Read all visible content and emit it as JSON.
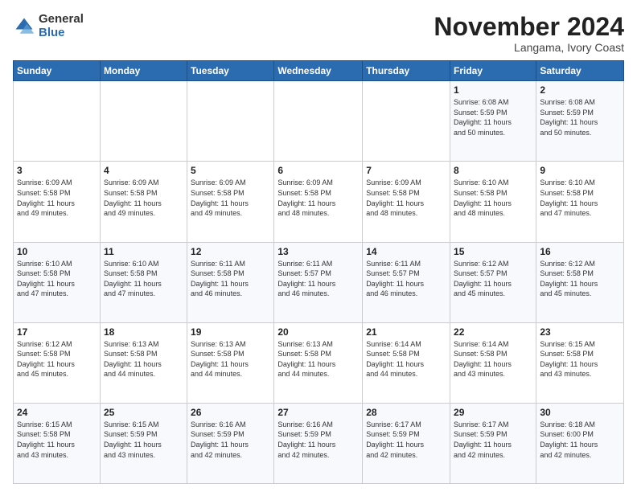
{
  "logo": {
    "general": "General",
    "blue": "Blue"
  },
  "header": {
    "title": "November 2024",
    "location": "Langama, Ivory Coast"
  },
  "weekdays": [
    "Sunday",
    "Monday",
    "Tuesday",
    "Wednesday",
    "Thursday",
    "Friday",
    "Saturday"
  ],
  "weeks": [
    [
      {
        "day": "",
        "info": ""
      },
      {
        "day": "",
        "info": ""
      },
      {
        "day": "",
        "info": ""
      },
      {
        "day": "",
        "info": ""
      },
      {
        "day": "",
        "info": ""
      },
      {
        "day": "1",
        "info": "Sunrise: 6:08 AM\nSunset: 5:59 PM\nDaylight: 11 hours\nand 50 minutes."
      },
      {
        "day": "2",
        "info": "Sunrise: 6:08 AM\nSunset: 5:59 PM\nDaylight: 11 hours\nand 50 minutes."
      }
    ],
    [
      {
        "day": "3",
        "info": "Sunrise: 6:09 AM\nSunset: 5:58 PM\nDaylight: 11 hours\nand 49 minutes."
      },
      {
        "day": "4",
        "info": "Sunrise: 6:09 AM\nSunset: 5:58 PM\nDaylight: 11 hours\nand 49 minutes."
      },
      {
        "day": "5",
        "info": "Sunrise: 6:09 AM\nSunset: 5:58 PM\nDaylight: 11 hours\nand 49 minutes."
      },
      {
        "day": "6",
        "info": "Sunrise: 6:09 AM\nSunset: 5:58 PM\nDaylight: 11 hours\nand 48 minutes."
      },
      {
        "day": "7",
        "info": "Sunrise: 6:09 AM\nSunset: 5:58 PM\nDaylight: 11 hours\nand 48 minutes."
      },
      {
        "day": "8",
        "info": "Sunrise: 6:10 AM\nSunset: 5:58 PM\nDaylight: 11 hours\nand 48 minutes."
      },
      {
        "day": "9",
        "info": "Sunrise: 6:10 AM\nSunset: 5:58 PM\nDaylight: 11 hours\nand 47 minutes."
      }
    ],
    [
      {
        "day": "10",
        "info": "Sunrise: 6:10 AM\nSunset: 5:58 PM\nDaylight: 11 hours\nand 47 minutes."
      },
      {
        "day": "11",
        "info": "Sunrise: 6:10 AM\nSunset: 5:58 PM\nDaylight: 11 hours\nand 47 minutes."
      },
      {
        "day": "12",
        "info": "Sunrise: 6:11 AM\nSunset: 5:58 PM\nDaylight: 11 hours\nand 46 minutes."
      },
      {
        "day": "13",
        "info": "Sunrise: 6:11 AM\nSunset: 5:57 PM\nDaylight: 11 hours\nand 46 minutes."
      },
      {
        "day": "14",
        "info": "Sunrise: 6:11 AM\nSunset: 5:57 PM\nDaylight: 11 hours\nand 46 minutes."
      },
      {
        "day": "15",
        "info": "Sunrise: 6:12 AM\nSunset: 5:57 PM\nDaylight: 11 hours\nand 45 minutes."
      },
      {
        "day": "16",
        "info": "Sunrise: 6:12 AM\nSunset: 5:58 PM\nDaylight: 11 hours\nand 45 minutes."
      }
    ],
    [
      {
        "day": "17",
        "info": "Sunrise: 6:12 AM\nSunset: 5:58 PM\nDaylight: 11 hours\nand 45 minutes."
      },
      {
        "day": "18",
        "info": "Sunrise: 6:13 AM\nSunset: 5:58 PM\nDaylight: 11 hours\nand 44 minutes."
      },
      {
        "day": "19",
        "info": "Sunrise: 6:13 AM\nSunset: 5:58 PM\nDaylight: 11 hours\nand 44 minutes."
      },
      {
        "day": "20",
        "info": "Sunrise: 6:13 AM\nSunset: 5:58 PM\nDaylight: 11 hours\nand 44 minutes."
      },
      {
        "day": "21",
        "info": "Sunrise: 6:14 AM\nSunset: 5:58 PM\nDaylight: 11 hours\nand 44 minutes."
      },
      {
        "day": "22",
        "info": "Sunrise: 6:14 AM\nSunset: 5:58 PM\nDaylight: 11 hours\nand 43 minutes."
      },
      {
        "day": "23",
        "info": "Sunrise: 6:15 AM\nSunset: 5:58 PM\nDaylight: 11 hours\nand 43 minutes."
      }
    ],
    [
      {
        "day": "24",
        "info": "Sunrise: 6:15 AM\nSunset: 5:58 PM\nDaylight: 11 hours\nand 43 minutes."
      },
      {
        "day": "25",
        "info": "Sunrise: 6:15 AM\nSunset: 5:59 PM\nDaylight: 11 hours\nand 43 minutes."
      },
      {
        "day": "26",
        "info": "Sunrise: 6:16 AM\nSunset: 5:59 PM\nDaylight: 11 hours\nand 42 minutes."
      },
      {
        "day": "27",
        "info": "Sunrise: 6:16 AM\nSunset: 5:59 PM\nDaylight: 11 hours\nand 42 minutes."
      },
      {
        "day": "28",
        "info": "Sunrise: 6:17 AM\nSunset: 5:59 PM\nDaylight: 11 hours\nand 42 minutes."
      },
      {
        "day": "29",
        "info": "Sunrise: 6:17 AM\nSunset: 5:59 PM\nDaylight: 11 hours\nand 42 minutes."
      },
      {
        "day": "30",
        "info": "Sunrise: 6:18 AM\nSunset: 6:00 PM\nDaylight: 11 hours\nand 42 minutes."
      }
    ]
  ]
}
